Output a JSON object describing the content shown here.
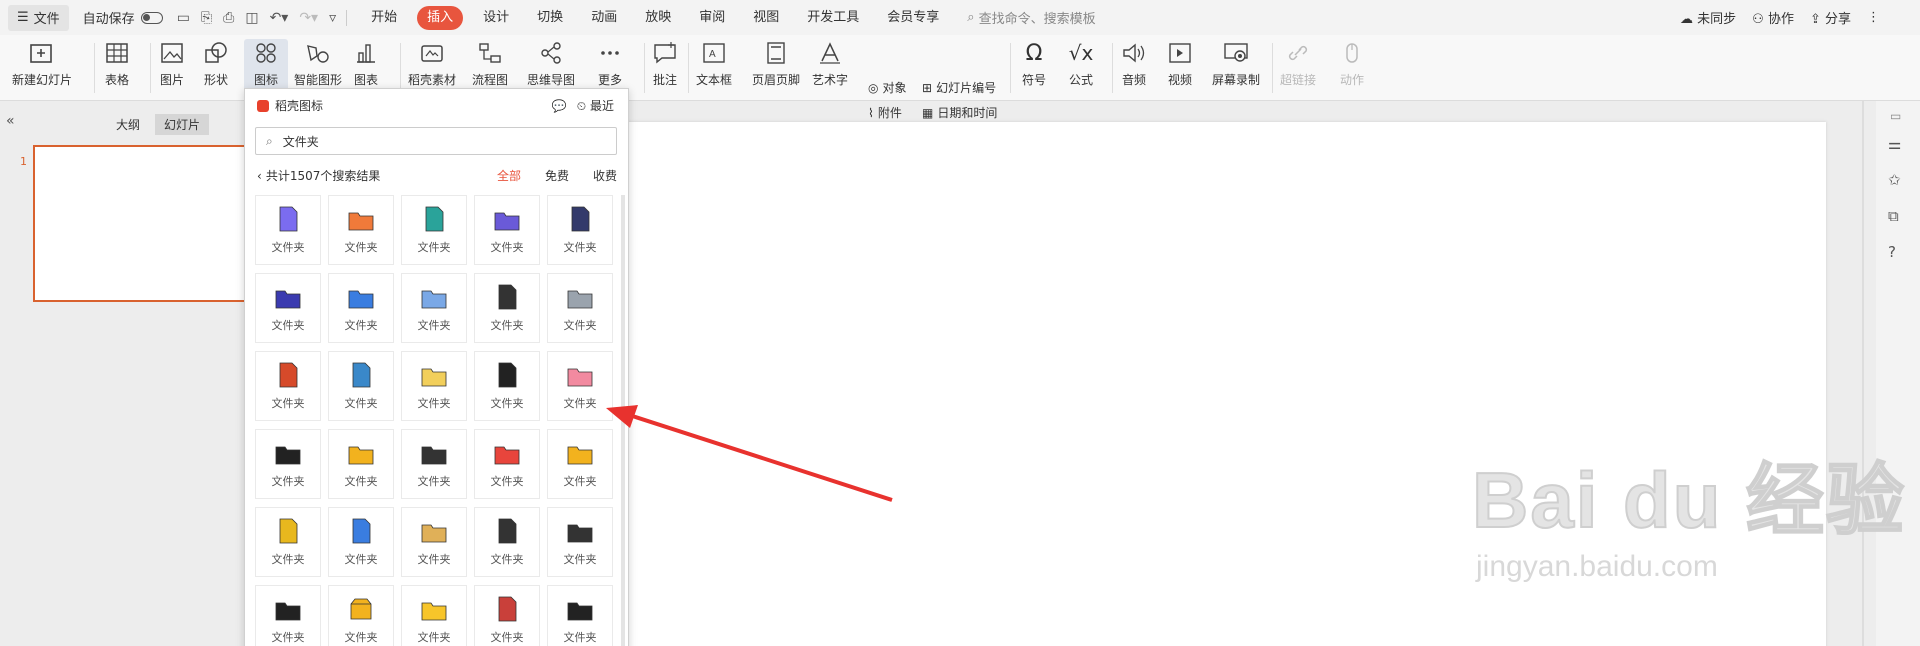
{
  "menubar": {
    "file": "文件",
    "autosave": "自动保存",
    "tabs": [
      "开始",
      "插入",
      "设计",
      "切换",
      "动画",
      "放映",
      "审阅",
      "视图",
      "开发工具",
      "会员专享"
    ],
    "active_tab": "插入",
    "search": "查找命令、搜索模板",
    "sync": "未同步",
    "collab": "协作",
    "share": "分享"
  },
  "ribbon": {
    "new_slide": "新建幻灯片",
    "table": "表格",
    "picture": "图片",
    "shape": "形状",
    "icon": "图标",
    "smartart": "智能图形",
    "chart": "图表",
    "material": "稻壳素材",
    "flowchart": "流程图",
    "mindmap": "思维导图",
    "more": "更多",
    "comment": "批注",
    "textbox": "文本框",
    "header_footer": "页眉页脚",
    "wordart": "艺术字",
    "object": "对象",
    "attachment": "附件",
    "slide_number": "幻灯片编号",
    "datetime": "日期和时间",
    "symbol": "符号",
    "formula": "公式",
    "audio": "音频",
    "video": "视频",
    "screen_record": "屏幕录制",
    "hyperlink": "超链接",
    "action": "动作"
  },
  "leftpane": {
    "outline": "大纲",
    "slides": "幻灯片",
    "slide_number": "1"
  },
  "panel": {
    "title": "稻壳图标",
    "recent": "最近",
    "search_value": "文件夹",
    "result_count": "共计1507个搜索结果",
    "filters": [
      "全部",
      "免费",
      "收费"
    ],
    "active_filter": "全部",
    "item_label": "文件夹",
    "items": [
      {
        "icon": "clipboard-list-icon",
        "color": "#7b6cf0"
      },
      {
        "icon": "orange-folder-doc-icon",
        "color": "#f07a3a"
      },
      {
        "icon": "teal-notebook-icon",
        "color": "#2aa39a"
      },
      {
        "icon": "purple-folder-icon",
        "color": "#6a5ad8"
      },
      {
        "icon": "binder-icon",
        "color": "#333a6b"
      },
      {
        "icon": "briefcase-folder-icon",
        "color": "#3b3bb0"
      },
      {
        "icon": "browser-folder-icon",
        "color": "#3a7de0"
      },
      {
        "icon": "id-card-folder-icon",
        "color": "#7aa8e6"
      },
      {
        "icon": "stacked-documents-icon",
        "color": "#333333"
      },
      {
        "icon": "tray-folder-icon",
        "color": "#9aa3ad"
      },
      {
        "icon": "stamp-icon",
        "color": "#d64a2a"
      },
      {
        "icon": "bookshelf-circle-icon",
        "color": "#3a88c9"
      },
      {
        "icon": "cloud-folder-icon",
        "color": "#f2cf5b"
      },
      {
        "icon": "book-binders-icon",
        "color": "#222222"
      },
      {
        "icon": "pink-folder-icon",
        "color": "#f28aa0"
      },
      {
        "icon": "open-folder-black-icon",
        "color": "#222222"
      },
      {
        "icon": "yellow-folder-3d-icon",
        "color": "#f2b21e"
      },
      {
        "icon": "open-folder-outline-icon",
        "color": "#333333"
      },
      {
        "icon": "red-outline-folder-icon",
        "color": "#e8453c"
      },
      {
        "icon": "yellow-folder-3d-icon",
        "color": "#f2b21e"
      },
      {
        "icon": "yellow-binders-icon",
        "color": "#e8b81e"
      },
      {
        "icon": "blue-clipboard-icon",
        "color": "#3a7de0"
      },
      {
        "icon": "beige-folder-icon",
        "color": "#e0b058"
      },
      {
        "icon": "black-clipboard-icon",
        "color": "#333333"
      },
      {
        "icon": "network-folder-icon",
        "color": "#333333"
      },
      {
        "icon": "black-open-folder-icon",
        "color": "#222222"
      },
      {
        "icon": "yellow-box-icon",
        "color": "#f2b21e"
      },
      {
        "icon": "yellow-folder-icon",
        "color": "#f7c52a"
      },
      {
        "icon": "colorful-binders-icon",
        "color": "#c9403a"
      },
      {
        "icon": "dark-folder-icon",
        "color": "#222222"
      }
    ]
  },
  "watermark": {
    "logo": "Bai du 经验",
    "url": "jingyan.baidu.com"
  }
}
